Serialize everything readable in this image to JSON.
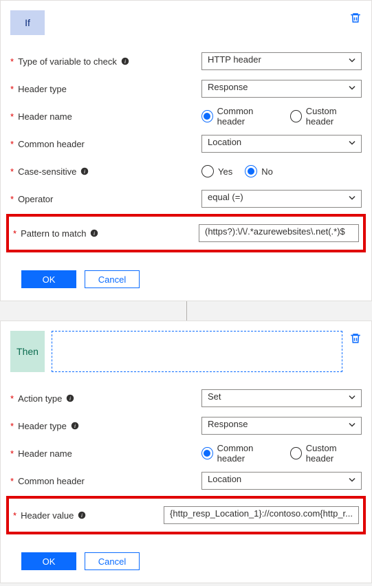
{
  "if_card": {
    "badge": "If",
    "fields": {
      "type_of_variable": {
        "label": "Type of variable to check",
        "value": "HTTP header"
      },
      "header_type": {
        "label": "Header type",
        "value": "Response"
      },
      "header_name": {
        "label": "Header name",
        "common": "Common header",
        "custom": "Custom header",
        "selected": "common"
      },
      "common_header": {
        "label": "Common header",
        "value": "Location"
      },
      "case_sensitive": {
        "label": "Case-sensitive",
        "yes": "Yes",
        "no": "No",
        "selected": "no"
      },
      "operator": {
        "label": "Operator",
        "value": "equal (=)"
      },
      "pattern": {
        "label": "Pattern to match",
        "value": "(https?):\\/\\/.*azurewebsites\\.net(.*)$"
      }
    },
    "buttons": {
      "ok": "OK",
      "cancel": "Cancel"
    }
  },
  "then_card": {
    "badge": "Then",
    "fields": {
      "action_type": {
        "label": "Action type",
        "value": "Set"
      },
      "header_type": {
        "label": "Header type",
        "value": "Response"
      },
      "header_name": {
        "label": "Header name",
        "common": "Common header",
        "custom": "Custom header",
        "selected": "common"
      },
      "common_header": {
        "label": "Common header",
        "value": "Location"
      },
      "header_value": {
        "label": "Header value",
        "value": "{http_resp_Location_1}://contoso.com{http_r..."
      }
    },
    "buttons": {
      "ok": "OK",
      "cancel": "Cancel"
    }
  }
}
